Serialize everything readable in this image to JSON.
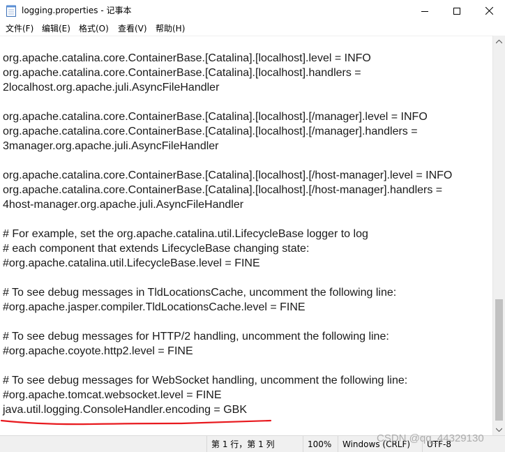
{
  "window": {
    "title": "logging.properties - 记事本",
    "controls": {
      "minimize": "minimize-icon",
      "maximize": "maximize-icon",
      "close": "close-icon"
    }
  },
  "menu": {
    "items": [
      "文件(F)",
      "编辑(E)",
      "格式(O)",
      "查看(V)",
      "帮助(H)"
    ]
  },
  "editor": {
    "lines": [
      "org.apache.catalina.core.ContainerBase.[Catalina].[localhost].level = INFO",
      "org.apache.catalina.core.ContainerBase.[Catalina].[localhost].handlers =",
      "2localhost.org.apache.juli.AsyncFileHandler",
      "",
      "org.apache.catalina.core.ContainerBase.[Catalina].[localhost].[/manager].level = INFO",
      "org.apache.catalina.core.ContainerBase.[Catalina].[localhost].[/manager].handlers =",
      "3manager.org.apache.juli.AsyncFileHandler",
      "",
      "org.apache.catalina.core.ContainerBase.[Catalina].[localhost].[/host-manager].level = INFO",
      "org.apache.catalina.core.ContainerBase.[Catalina].[localhost].[/host-manager].handlers =",
      "4host-manager.org.apache.juli.AsyncFileHandler",
      "",
      "# For example, set the org.apache.catalina.util.LifecycleBase logger to log",
      "# each component that extends LifecycleBase changing state:",
      "#org.apache.catalina.util.LifecycleBase.level = FINE",
      "",
      "# To see debug messages in TldLocationsCache, uncomment the following line:",
      "#org.apache.jasper.compiler.TldLocationsCache.level = FINE",
      "",
      "# To see debug messages for HTTP/2 handling, uncomment the following line:",
      "#org.apache.coyote.http2.level = FINE",
      "",
      "# To see debug messages for WebSocket handling, uncomment the following line:",
      "#org.apache.tomcat.websocket.level = FINE",
      "java.util.logging.ConsoleHandler.encoding = GBK"
    ],
    "highlight_color": "#e8191e"
  },
  "status": {
    "position": "第 1 行，第 1 列",
    "zoom": "100%",
    "line_ending": "Windows (CRLF)",
    "encoding": "UTF-8"
  },
  "watermark": "CSDN @qq_44329130"
}
